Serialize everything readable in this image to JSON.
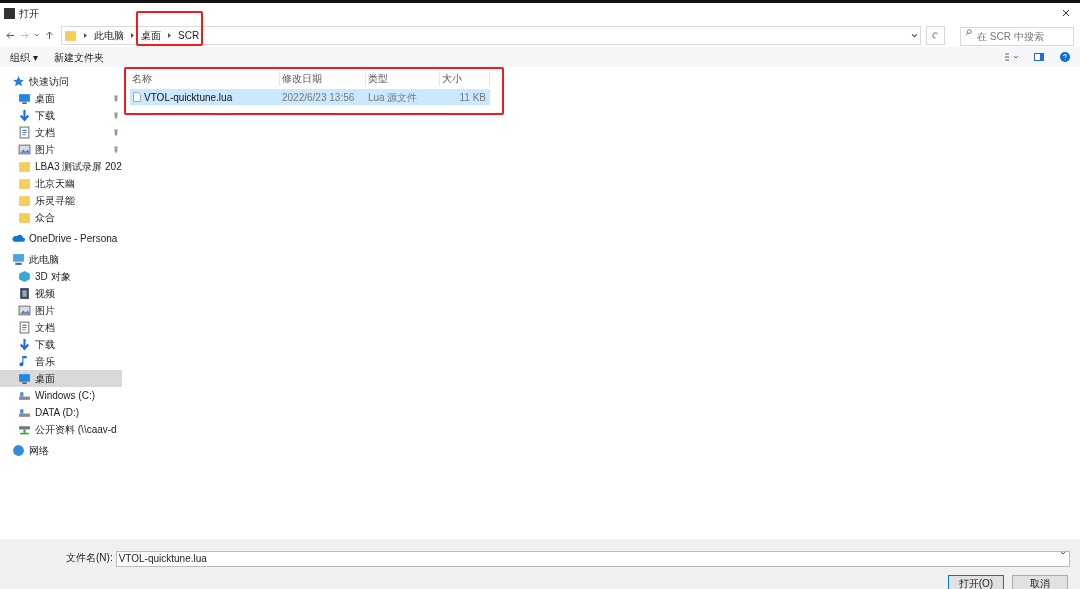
{
  "window": {
    "title": "打开"
  },
  "breadcrumb": [
    "此电脑",
    "桌面",
    "SCR"
  ],
  "search": {
    "placeholder": "在 SCR 中搜索"
  },
  "toolbar": [
    "组织 ▾",
    "新建文件夹"
  ],
  "sidebar": [
    {
      "label": "快速访问",
      "kind": "star",
      "selected": false,
      "children": [
        {
          "label": "桌面",
          "kind": "desktop",
          "selected": false,
          "pinned": true
        },
        {
          "label": "下载",
          "kind": "download",
          "selected": false,
          "pinned": true
        },
        {
          "label": "文档",
          "kind": "doc",
          "selected": false,
          "pinned": true
        },
        {
          "label": "图片",
          "kind": "image",
          "selected": false,
          "pinned": true
        },
        {
          "label": "LBA3 测试录屏 202",
          "kind": "folder",
          "selected": false,
          "pinned": false
        },
        {
          "label": "北京天幽",
          "kind": "folder",
          "selected": false,
          "pinned": false
        },
        {
          "label": "乐灵寻能",
          "kind": "folder",
          "selected": false,
          "pinned": false
        },
        {
          "label": "众合",
          "kind": "folder",
          "selected": false,
          "pinned": false
        }
      ]
    },
    {
      "label": "OneDrive - Persona",
      "kind": "cloud",
      "selected": false
    },
    {
      "label": "此电脑",
      "kind": "pc",
      "selected": false,
      "children": [
        {
          "label": "3D 对象",
          "kind": "cube",
          "selected": false,
          "pinned": false
        },
        {
          "label": "视频",
          "kind": "video",
          "selected": false,
          "pinned": false
        },
        {
          "label": "图片",
          "kind": "image",
          "selected": false,
          "pinned": false
        },
        {
          "label": "文档",
          "kind": "doc",
          "selected": false,
          "pinned": false
        },
        {
          "label": "下载",
          "kind": "download",
          "selected": false,
          "pinned": false
        },
        {
          "label": "音乐",
          "kind": "music",
          "selected": false,
          "pinned": false
        },
        {
          "label": "桌面",
          "kind": "desktop",
          "selected": true,
          "pinned": false
        },
        {
          "label": "Windows (C:)",
          "kind": "drive",
          "selected": false,
          "pinned": false
        },
        {
          "label": "DATA (D:)",
          "kind": "drive",
          "selected": false,
          "pinned": false
        },
        {
          "label": "公开资料 (\\\\caav-d",
          "kind": "netdrive",
          "selected": false,
          "pinned": false
        }
      ]
    },
    {
      "label": "网络",
      "kind": "network",
      "selected": false
    }
  ],
  "table": {
    "columns": [
      "名称",
      "修改日期",
      "类型",
      "大小"
    ],
    "rows": [
      {
        "cells": [
          "VTOL-quicktune.lua",
          "2022/6/23 13:56",
          "Lua 源文件",
          "11 KB"
        ],
        "selected": true
      }
    ]
  },
  "file_name": {
    "label": "文件名(N):",
    "value": "VTOL-quicktune.lua"
  },
  "buttons": [
    "打开(O)",
    "取消"
  ]
}
